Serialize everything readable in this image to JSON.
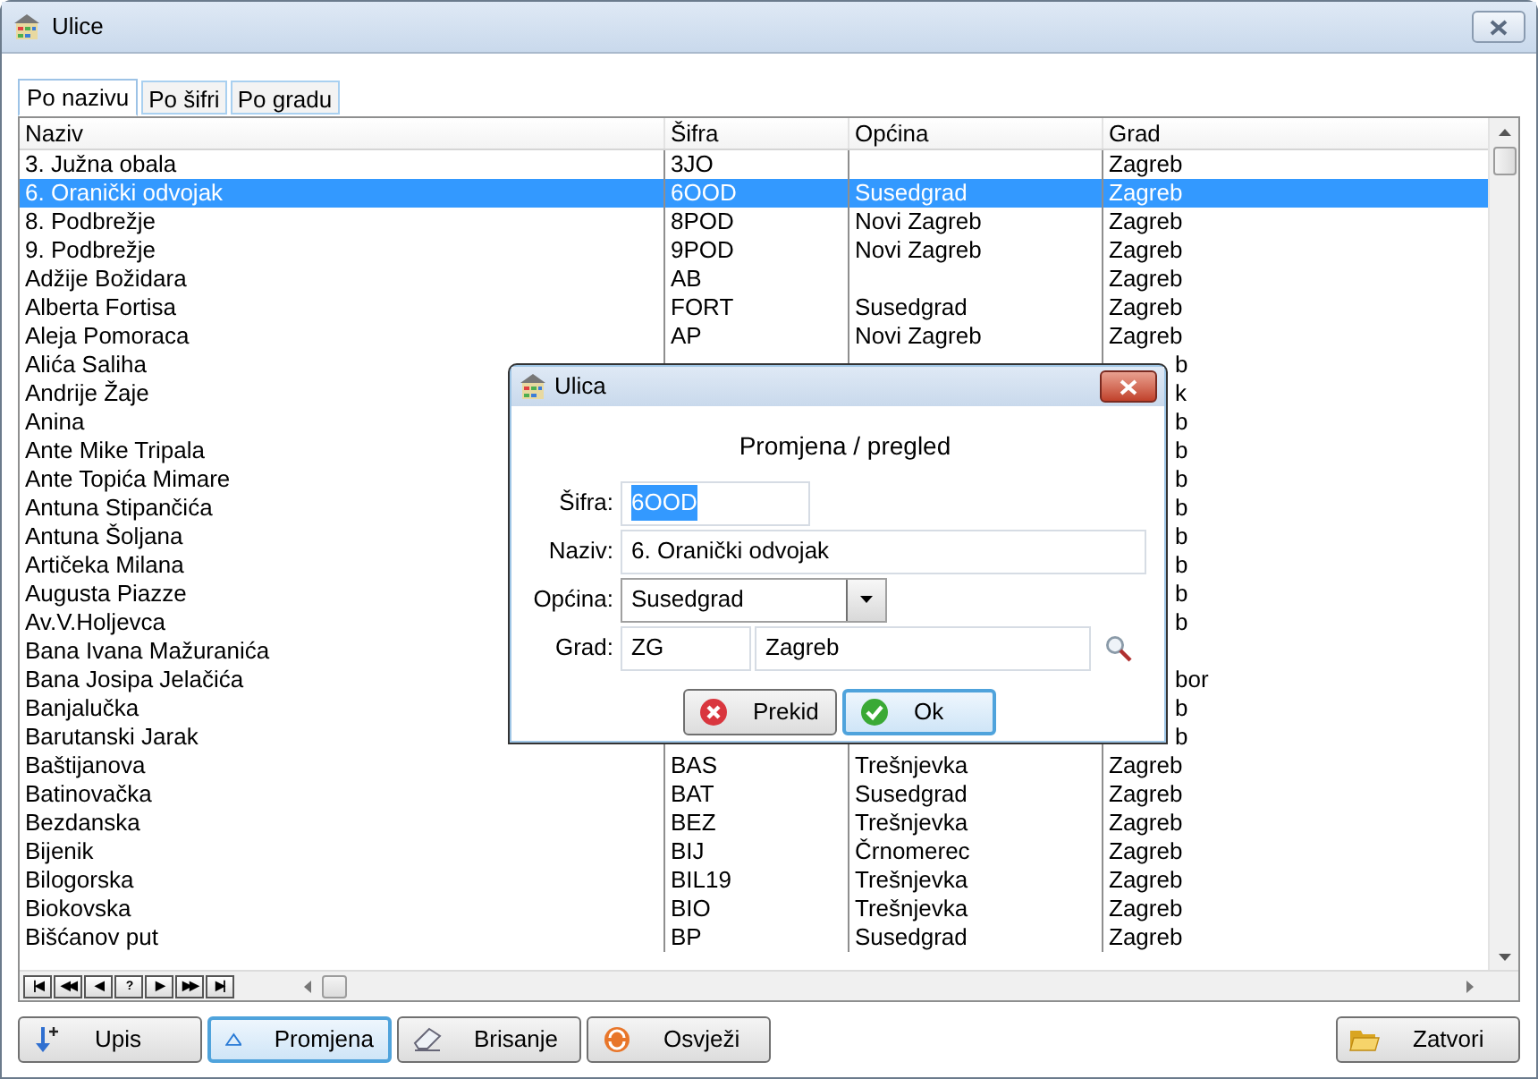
{
  "window": {
    "title": "Ulice"
  },
  "tabs": [
    {
      "label": "Po nazivu",
      "selected": true
    },
    {
      "label": "Po šifri",
      "selected": false
    },
    {
      "label": "Po gradu",
      "selected": false
    }
  ],
  "table": {
    "columns": [
      "Naziv",
      "Šifra",
      "Općina",
      "Grad"
    ],
    "rows": [
      {
        "naziv": "3. Južna obala",
        "sifra": "3JO",
        "grad": "Zagreb",
        "selected": false
      },
      {
        "naziv": "6. Oranički odvojak",
        "sifra": "6OOD",
        "opcina": "Susedgrad",
        "grad": "Zagreb",
        "selected": true
      },
      {
        "naziv": "8. Podbrežje",
        "sifra": "8POD",
        "opcina": "Novi Zagreb",
        "grad": "Zagreb",
        "selected": false
      },
      {
        "naziv": "9. Podbrežje",
        "sifra": "9POD",
        "opcina": "Novi Zagreb",
        "grad": "Zagreb",
        "selected": false
      },
      {
        "naziv": "Adžije Božidara",
        "sifra": "AB",
        "grad": "Zagreb",
        "selected": false
      },
      {
        "naziv": "Alberta Fortisa",
        "sifra": "FORT",
        "opcina": "Susedgrad",
        "grad": "Zagreb",
        "selected": false
      },
      {
        "naziv": "Aleja Pomoraca",
        "sifra": "AP",
        "opcina": "Novi Zagreb",
        "grad": "Zagreb",
        "selected": false
      },
      {
        "naziv": "Alića Saliha",
        "grad": "b",
        "partly_hidden": true,
        "selected": false
      },
      {
        "naziv": "Andrije Žaje",
        "grad": "k",
        "partly_hidden": true,
        "selected": false
      },
      {
        "naziv": "Anina",
        "grad": "b",
        "partly_hidden": true,
        "selected": false
      },
      {
        "naziv": "Ante Mike Tripala",
        "grad": "b",
        "partly_hidden": true,
        "selected": false
      },
      {
        "naziv": "Ante Topića Mimare",
        "grad": "b",
        "partly_hidden": true,
        "selected": false
      },
      {
        "naziv": "Antuna Stipančića",
        "grad": "b",
        "partly_hidden": true,
        "selected": false
      },
      {
        "naziv": "Antuna Šoljana",
        "grad": "b",
        "partly_hidden": true,
        "selected": false
      },
      {
        "naziv": "Artičeka Milana",
        "grad": "b",
        "partly_hidden": true,
        "selected": false
      },
      {
        "naziv": "Augusta Piazze",
        "grad": "b",
        "partly_hidden": true,
        "selected": false
      },
      {
        "naziv": "Av.V.Holjevca",
        "grad": "b",
        "partly_hidden": true,
        "selected": false
      },
      {
        "naziv": "Bana Ivana Mažuranića",
        "selected": false
      },
      {
        "naziv": "Bana Josipa Jelačića",
        "grad": "bor",
        "partly_hidden": true,
        "selected": false
      },
      {
        "naziv": "Banjalučka",
        "grad": "b",
        "partly_hidden": true,
        "selected": false
      },
      {
        "naziv": "Barutanski Jarak",
        "grad": "b",
        "partly_hidden": true,
        "selected": false
      },
      {
        "naziv": "Baštijanova",
        "sifra": "BAS",
        "opcina": "Trešnjevka",
        "grad": "Zagreb",
        "selected": false
      },
      {
        "naziv": "Batinovačka",
        "sifra": "BAT",
        "opcina": "Susedgrad",
        "grad": "Zagreb",
        "selected": false
      },
      {
        "naziv": "Bezdanska",
        "sifra": "BEZ",
        "opcina": "Trešnjevka",
        "grad": "Zagreb",
        "selected": false
      },
      {
        "naziv": "Bijenik",
        "sifra": "BIJ",
        "opcina": "Črnomerec",
        "grad": "Zagreb",
        "selected": false
      },
      {
        "naziv": "Bilogorska",
        "sifra": "BIL19",
        "opcina": "Trešnjevka",
        "grad": "Zagreb",
        "selected": false
      },
      {
        "naziv": "Biokovska",
        "sifra": "BIO",
        "opcina": "Trešnjevka",
        "grad": "Zagreb",
        "selected": false
      },
      {
        "naziv": "Bišćanov put",
        "sifra": "BP",
        "opcina": "Susedgrad",
        "grad": "Zagreb",
        "selected": false
      }
    ]
  },
  "navigator": [
    "|◀",
    "◀◀",
    "◀",
    "?",
    "▶",
    "▶▶",
    "▶|"
  ],
  "buttons": [
    {
      "label": "Upis",
      "kind": "add",
      "focused": false
    },
    {
      "label": "Promjena",
      "kind": "edit",
      "focused": true
    },
    {
      "label": "Brisanje",
      "kind": "delete",
      "focused": false
    },
    {
      "label": "Osvježi",
      "kind": "refresh",
      "focused": false
    }
  ],
  "close_button": {
    "label": "Zatvori"
  },
  "dialog": {
    "title": "Ulica",
    "heading": "Promjena / pregled",
    "fields": [
      {
        "label": "Šifra:",
        "value": "6OOD",
        "kind": "text"
      },
      {
        "label": "Naziv:",
        "value": "6. Oranički odvojak",
        "kind": "text"
      },
      {
        "label": "Općina:",
        "value": "Susedgrad",
        "kind": "select"
      },
      {
        "label": "Grad:",
        "code": "ZG",
        "value": "Zagreb",
        "kind": "lookup"
      }
    ],
    "buttons": [
      {
        "label": "Prekid",
        "kind": "cancel",
        "focused": false
      },
      {
        "label": "Ok",
        "kind": "ok",
        "focused": true
      }
    ]
  }
}
